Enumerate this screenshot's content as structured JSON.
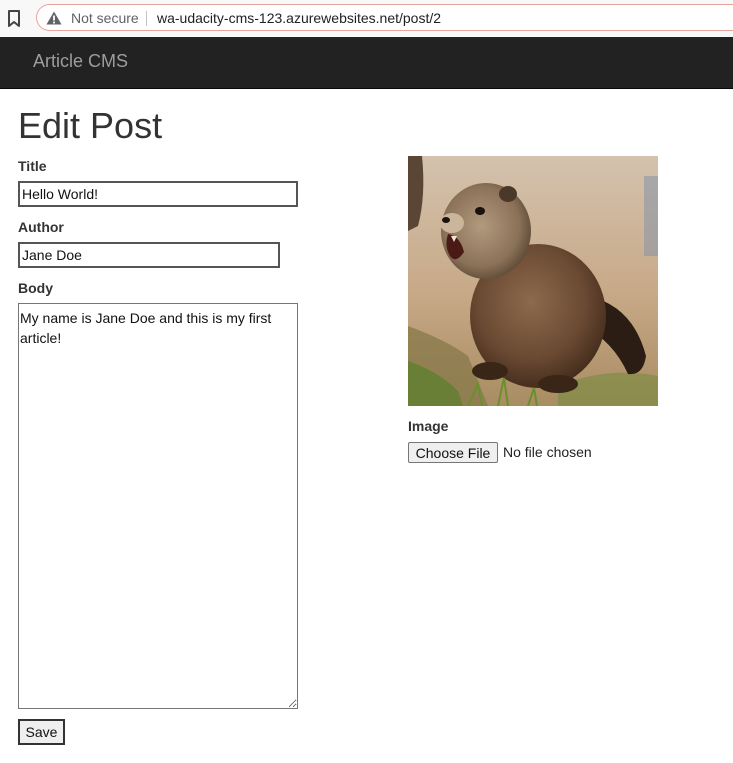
{
  "browser": {
    "security_label": "Not secure",
    "url": "wa-udacity-cms-123.azurewebsites.net/post/2"
  },
  "navbar": {
    "brand": "Article CMS"
  },
  "page": {
    "title": "Edit Post"
  },
  "form": {
    "title_label": "Title",
    "title_value": "Hello World!",
    "author_label": "Author",
    "author_value": "Jane Doe",
    "body_label": "Body",
    "body_value": "My name is Jane Doe and this is my first article!",
    "save_label": "Save"
  },
  "image_section": {
    "photo_subject": "groundhog",
    "label": "Image",
    "choose_label": "Choose File",
    "no_file_text": "No file chosen"
  }
}
